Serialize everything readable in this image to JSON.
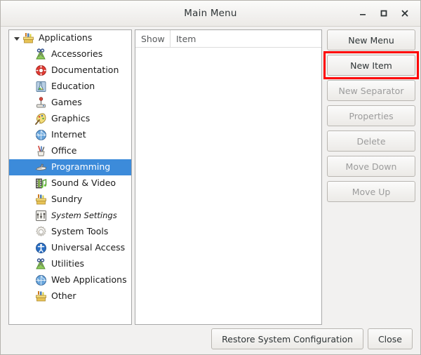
{
  "window": {
    "title": "Main Menu",
    "controls": [
      {
        "name": "minimize-button",
        "glyph": "minimize"
      },
      {
        "name": "maximize-button",
        "glyph": "maximize"
      },
      {
        "name": "close-button",
        "glyph": "close"
      }
    ]
  },
  "colors": {
    "selection": "#3c8bda",
    "highlight_box": "#fe0000",
    "window_background": "#f2f1f0",
    "enabled_text": "#2e3436",
    "disabled_text": "#9c9c9c"
  },
  "tree": {
    "items": [
      {
        "label": "Applications",
        "icon": "toolbox-icon",
        "level": 0,
        "expanded": true,
        "selected": false,
        "italic": false
      },
      {
        "label": "Accessories",
        "icon": "accessories-icon",
        "level": 1,
        "expanded": false,
        "selected": false,
        "italic": false
      },
      {
        "label": "Documentation",
        "icon": "lifebuoy-icon",
        "level": 1,
        "expanded": false,
        "selected": false,
        "italic": false
      },
      {
        "label": "Education",
        "icon": "flask-icon",
        "level": 1,
        "expanded": false,
        "selected": false,
        "italic": false
      },
      {
        "label": "Games",
        "icon": "joystick-icon",
        "level": 1,
        "expanded": false,
        "selected": false,
        "italic": false
      },
      {
        "label": "Graphics",
        "icon": "palette-brush-icon",
        "level": 1,
        "expanded": false,
        "selected": false,
        "italic": false
      },
      {
        "label": "Internet",
        "icon": "globe-icon",
        "level": 1,
        "expanded": false,
        "selected": false,
        "italic": false
      },
      {
        "label": "Office",
        "icon": "pen-cup-icon",
        "level": 1,
        "expanded": false,
        "selected": false,
        "italic": false
      },
      {
        "label": "Programming",
        "icon": "plane-tool-icon",
        "level": 1,
        "expanded": false,
        "selected": true,
        "italic": false
      },
      {
        "label": "Sound & Video",
        "icon": "film-music-icon",
        "level": 1,
        "expanded": false,
        "selected": false,
        "italic": false
      },
      {
        "label": "Sundry",
        "icon": "toolbox-icon",
        "level": 1,
        "expanded": false,
        "selected": false,
        "italic": false
      },
      {
        "label": "System Settings",
        "icon": "sliders-icon",
        "level": 1,
        "expanded": false,
        "selected": false,
        "italic": true
      },
      {
        "label": "System Tools",
        "icon": "gear-icon",
        "level": 1,
        "expanded": false,
        "selected": false,
        "italic": false
      },
      {
        "label": "Universal Access",
        "icon": "accessibility-icon",
        "level": 1,
        "expanded": false,
        "selected": false,
        "italic": false
      },
      {
        "label": "Utilities",
        "icon": "accessories-icon",
        "level": 1,
        "expanded": false,
        "selected": false,
        "italic": false
      },
      {
        "label": "Web Applications",
        "icon": "globe-icon",
        "level": 1,
        "expanded": false,
        "selected": false,
        "italic": false
      },
      {
        "label": "Other",
        "icon": "toolbox-icon",
        "level": 1,
        "expanded": false,
        "selected": false,
        "italic": false
      }
    ]
  },
  "item_list": {
    "columns": [
      {
        "label": "Show"
      },
      {
        "label": "Item"
      }
    ],
    "rows": []
  },
  "action_buttons": [
    {
      "label": "New Menu",
      "name": "new-menu-button",
      "disabled": false,
      "highlighted": false
    },
    {
      "label": "New Item",
      "name": "new-item-button",
      "disabled": false,
      "highlighted": true
    },
    {
      "label": "New Separator",
      "name": "new-separator-button",
      "disabled": true,
      "highlighted": false
    },
    {
      "label": "Properties",
      "name": "properties-button",
      "disabled": true,
      "highlighted": false
    },
    {
      "label": "Delete",
      "name": "delete-button",
      "disabled": true,
      "highlighted": false
    },
    {
      "label": "Move Down",
      "name": "move-down-button",
      "disabled": true,
      "highlighted": false
    },
    {
      "label": "Move Up",
      "name": "move-up-button",
      "disabled": true,
      "highlighted": false
    }
  ],
  "bottom_buttons": [
    {
      "label": "Restore System Configuration",
      "name": "restore-system-configuration-button"
    },
    {
      "label": "Close",
      "name": "close-dialog-button"
    }
  ]
}
